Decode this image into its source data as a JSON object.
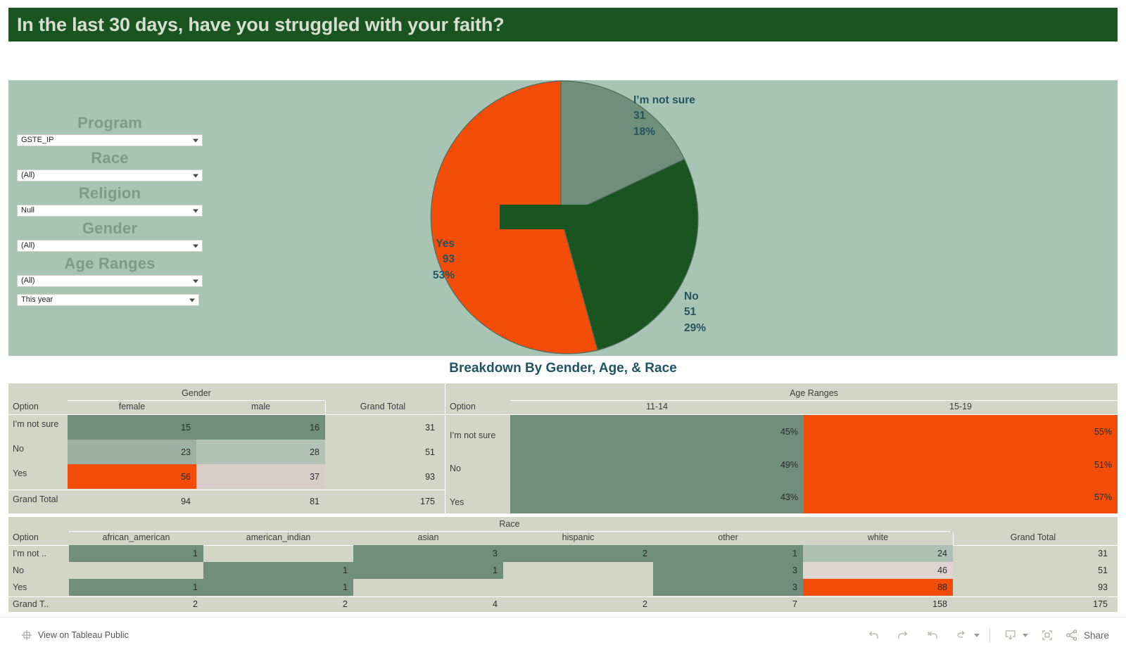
{
  "header": {
    "title": "In the last 30 days, have you struggled with your faith?"
  },
  "filters": {
    "items": [
      {
        "label": "Program",
        "value": "GSTE_IP"
      },
      {
        "label": "Race",
        "value": "(All)"
      },
      {
        "label": "Religion",
        "value": "Null"
      },
      {
        "label": "Gender",
        "value": "(All)"
      },
      {
        "label": "Age Ranges",
        "value": "(All)"
      }
    ],
    "date_filter": {
      "value": "This year"
    }
  },
  "breakdown": {
    "title": "Breakdown By Gender, Age, & Race"
  },
  "colors": {
    "title_bar": "#1a5420",
    "panel_green": "#a8c4b4",
    "orange": "#f44c09",
    "dark_green": "#1a5420",
    "sage": "#6f8f7c",
    "sage_light": "#9db0a4",
    "pink_gray": "#d8cdc9",
    "table_bg": "#d3d6c7",
    "label_teal": "#24555c"
  },
  "chart_data": [
    {
      "type": "pie",
      "title": "In the last 30 days, have you struggled with your faith?",
      "categories": [
        "I’m not sure",
        "No",
        "Yes"
      ],
      "values": [
        31,
        51,
        93
      ],
      "percents": [
        "18%",
        "29%",
        "53%"
      ],
      "total": 175,
      "slice_colors": [
        "#6f8f7c",
        "#1a5420",
        "#f44c09"
      ],
      "legend": "labels-on-chart",
      "labels": [
        {
          "name": "I’m not sure",
          "value": "31",
          "percent": "18%"
        },
        {
          "name": "No",
          "value": "51",
          "percent": "29%"
        },
        {
          "name": "Yes",
          "value": "93",
          "percent": "53%"
        }
      ]
    },
    {
      "type": "table",
      "title": "Gender",
      "row_header": "Option",
      "categories": [
        "female",
        "male"
      ],
      "grand_total_label": "Grand Total",
      "rows": [
        {
          "option": "I’m not sure",
          "cells": [
            "15",
            "16"
          ],
          "total": "31"
        },
        {
          "option": "No",
          "cells": [
            "23",
            "28"
          ],
          "total": "51"
        },
        {
          "option": "Yes",
          "cells": [
            "56",
            "37"
          ],
          "total": "93"
        }
      ],
      "grand_total_row": {
        "option": "Grand Total",
        "cells": [
          "94",
          "81"
        ],
        "total": "175"
      }
    },
    {
      "type": "table",
      "title": "Age Ranges",
      "row_header": "Option",
      "categories": [
        "11-14",
        "15-19"
      ],
      "rows": [
        {
          "option": "I’m not sure",
          "cells": [
            "45%",
            "55%"
          ]
        },
        {
          "option": "No",
          "cells": [
            "49%",
            "51%"
          ]
        },
        {
          "option": "Yes",
          "cells": [
            "43%",
            "57%"
          ]
        }
      ]
    },
    {
      "type": "table",
      "title": "Race",
      "row_header": "Option",
      "categories": [
        "african_american",
        "american_indian",
        "asian",
        "hispanic",
        "other",
        "white"
      ],
      "grand_total_label": "Grand Total",
      "rows": [
        {
          "option": "I’m not ..",
          "cells": [
            "1",
            "",
            "3",
            "2",
            "1",
            "24"
          ],
          "total": "31"
        },
        {
          "option": "No",
          "cells": [
            "",
            "1",
            "1",
            "",
            "3",
            "46"
          ],
          "total": "51"
        },
        {
          "option": "Yes",
          "cells": [
            "1",
            "1",
            "",
            "",
            "3",
            "88"
          ],
          "total": "93"
        }
      ],
      "grand_total_row": {
        "option": "Grand T..",
        "cells": [
          "2",
          "2",
          "4",
          "2",
          "7",
          "158"
        ],
        "total": "175"
      }
    }
  ],
  "toolbar": {
    "view_link": "View on Tableau Public",
    "share_label": "Share",
    "buttons": [
      "undo-icon",
      "redo-icon",
      "revert-icon",
      "refresh-icon",
      "pause-icon",
      "download-icon",
      "fullscreen-icon",
      "share-icon"
    ]
  }
}
